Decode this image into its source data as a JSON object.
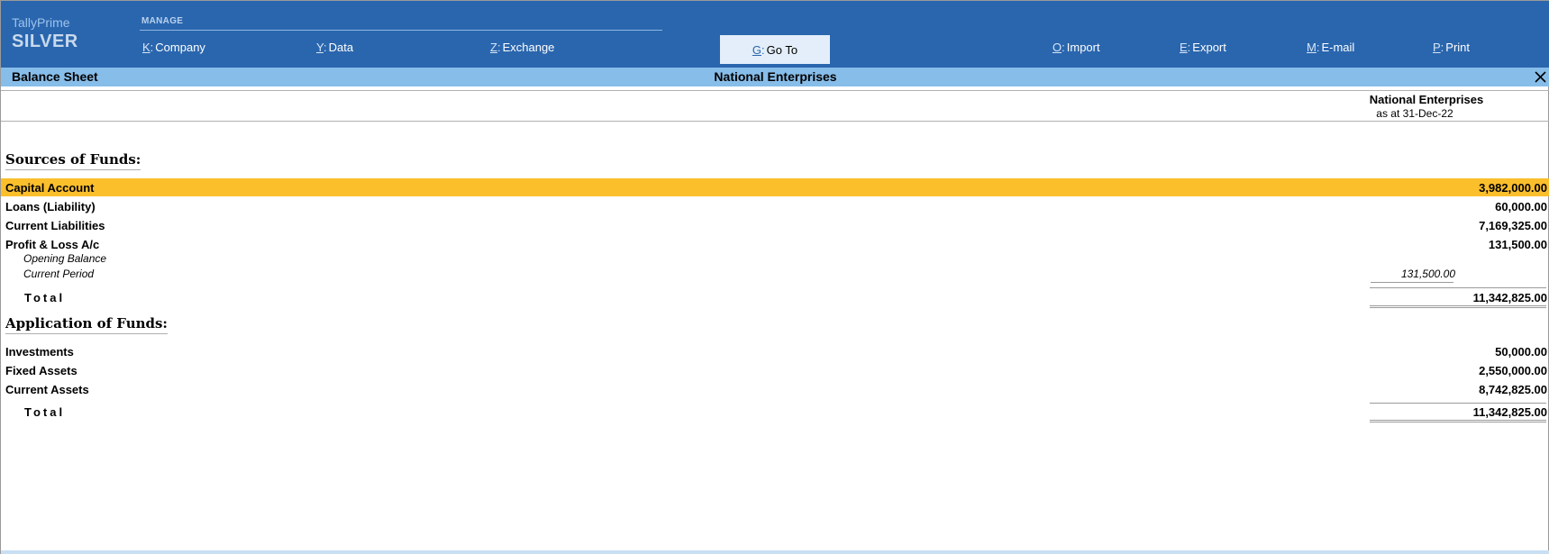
{
  "app": {
    "name": "TallyPrime",
    "edition": "SILVER"
  },
  "topbar": {
    "section_label": "MANAGE",
    "menu": [
      {
        "key": "K",
        "label": "Company"
      },
      {
        "key": "Y",
        "label": "Data"
      },
      {
        "key": "Z",
        "label": "Exchange"
      },
      {
        "key": "G",
        "label": "Go To"
      },
      {
        "key": "O",
        "label": "Import"
      },
      {
        "key": "E",
        "label": "Export"
      },
      {
        "key": "M",
        "label": "E-mail"
      },
      {
        "key": "P",
        "label": "Print"
      }
    ]
  },
  "report": {
    "title": "Balance Sheet",
    "company": "National Enterprises",
    "column_company": "National Enterprises",
    "column_date": "as at 31-Dec-22"
  },
  "sources": {
    "heading": "Sources of Funds:",
    "rows": [
      {
        "label": "Capital Account",
        "amount": "3,982,000.00"
      },
      {
        "label": "Loans (Liability)",
        "amount": "60,000.00"
      },
      {
        "label": "Current Liabilities",
        "amount": "7,169,325.00"
      },
      {
        "label": "Profit & Loss A/c",
        "amount": "131,500.00"
      }
    ],
    "pl_details": [
      {
        "label": "Opening Balance",
        "amount": ""
      },
      {
        "label": "Current Period",
        "amount": "131,500.00"
      }
    ],
    "total_label": "Total",
    "total_amount": "11,342,825.00"
  },
  "application": {
    "heading": "Application of Funds:",
    "rows": [
      {
        "label": "Investments",
        "amount": "50,000.00"
      },
      {
        "label": "Fixed Assets",
        "amount": "2,550,000.00"
      },
      {
        "label": "Current Assets",
        "amount": "8,742,825.00"
      }
    ],
    "total_label": "Total",
    "total_amount": "11,342,825.00"
  },
  "colors": {
    "topbar": "#2a66ae",
    "titlebar": "#87bde9",
    "selected_row": "#fbbf2c"
  }
}
